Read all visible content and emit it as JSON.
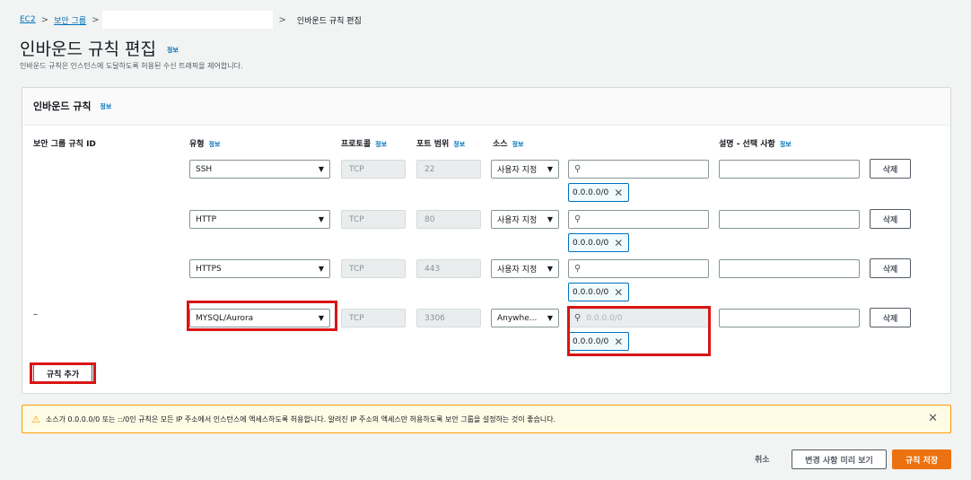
{
  "breadcrumb": {
    "ec2": "EC2",
    "security_groups": "보안 그룹",
    "current": "인바운드 규칙 편집"
  },
  "page": {
    "title": "인바운드 규칙 편집",
    "info": "정보",
    "description": "인바운드 규칙은 인스턴스에 도달하도록 허용된 수신 트래픽을 제어합니다."
  },
  "panel": {
    "title": "인바운드 규칙",
    "info": "정보"
  },
  "columns": {
    "rule_id": "보안 그룹 규칙 ID",
    "type": "유형",
    "protocol": "프로토콜",
    "port_range": "포트 범위",
    "source": "소스",
    "description": "설명 - 선택 사항",
    "info": "정보"
  },
  "rules": [
    {
      "rule_id": "",
      "type": "SSH",
      "protocol": "TCP",
      "port": "22",
      "source_type": "사용자 지정",
      "source_search": "",
      "cidr": "0.0.0.0/0",
      "delete": "삭제"
    },
    {
      "rule_id": "",
      "type": "HTTP",
      "protocol": "TCP",
      "port": "80",
      "source_type": "사용자 지정",
      "source_search": "",
      "cidr": "0.0.0.0/0",
      "delete": "삭제"
    },
    {
      "rule_id": "",
      "type": "HTTPS",
      "protocol": "TCP",
      "port": "443",
      "source_type": "사용자 지정",
      "source_search": "",
      "cidr": "0.0.0.0/0",
      "delete": "삭제"
    },
    {
      "rule_id": "–",
      "type": "MYSQL/Aurora",
      "protocol": "TCP",
      "port": "3306",
      "source_type": "Anywhe...",
      "source_search": "0.0.0.0/0",
      "cidr": "0.0.0.0/0",
      "delete": "삭제"
    }
  ],
  "add_rule": "규칙 추가",
  "warning": {
    "text": "소스가 0.0.0.0/0 또는 ::/0인 규칙은 모든 IP 주소에서 인스턴스에 액세스하도록 허용합니다. 알려진 IP 주소의 액세스만 허용하도록 보안 그룹을 설정하는 것이 좋습니다."
  },
  "footer": {
    "cancel": "취소",
    "preview": "변경 사항 미리 보기",
    "save": "규칙 저장"
  },
  "colors": {
    "accent": "#0073bb",
    "primary_button": "#ec7211",
    "highlight": "#d91515",
    "warning_border": "#ff9900"
  },
  "icons": {
    "separator": "chevron-right-icon",
    "dropdown": "caret-down-icon",
    "search": "search-icon",
    "remove": "close-icon",
    "warning": "warning-icon"
  }
}
